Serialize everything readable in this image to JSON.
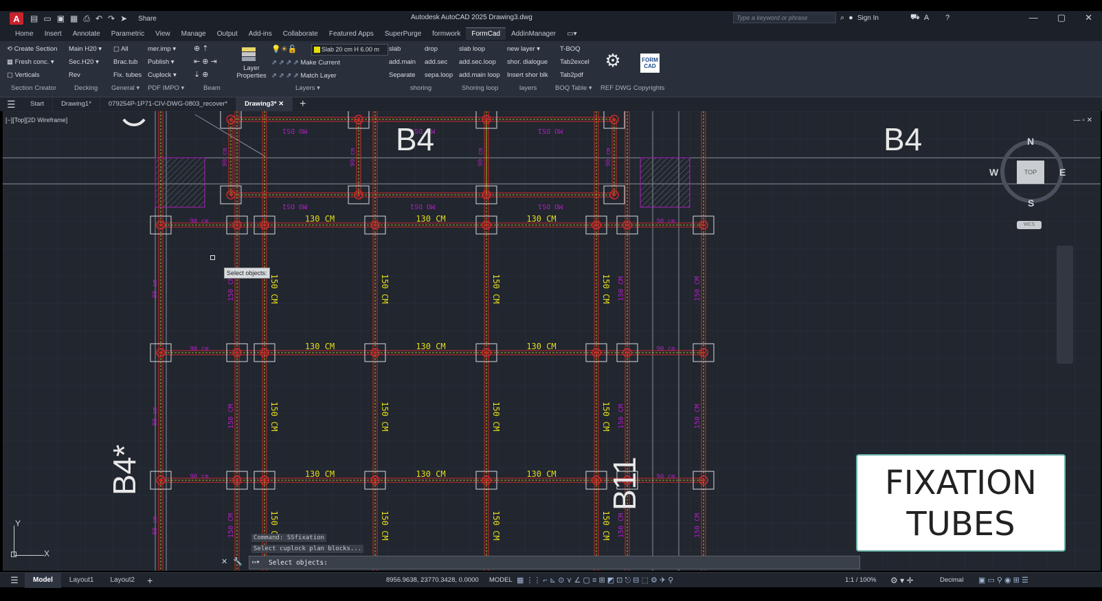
{
  "titlebar": {
    "app_logo": "A",
    "share": "Share",
    "title": "Autodesk AutoCAD 2025   Drawing3.dwg",
    "search_placeholder": "Type a keyword or phrase",
    "sign_in": "Sign In"
  },
  "menu_tabs": [
    "Home",
    "Insert",
    "Annotate",
    "Parametric",
    "View",
    "Manage",
    "Output",
    "Add-ins",
    "Collaborate",
    "Featured Apps",
    "SuperPurge",
    "formwork",
    "FormCad",
    "AddinManager"
  ],
  "ribbon": {
    "col1": [
      "Create Section",
      "Fresh conc.",
      "Verticals"
    ],
    "col1_group": "Section Creator",
    "col2": [
      "Main H20",
      "Sec.H20",
      ""
    ],
    "col2_group": "Decking",
    "col3": [
      "All",
      "Brac.tub",
      "Fix. tubes"
    ],
    "col3_group": "General",
    "col4": [
      "mer.imp",
      "Publish",
      "Cuplock"
    ],
    "col4_group": "PDF IMPO",
    "col5_group": "Beam",
    "layer_props": "Layer Properties",
    "layer_combo": "Slab 20 cm H 6.00 m",
    "make_current": "Make Current",
    "match_layer": "Match Layer",
    "layers_group": "Layers",
    "col_shoring": [
      "slab",
      "add.main",
      "Separate"
    ],
    "col_shoring2": [
      "drop",
      "add.sec",
      "sepa.loop"
    ],
    "shoring_group": "shoring",
    "col_loop": [
      "slab loop",
      "add.sec.loop",
      "add.main loop"
    ],
    "loop_group": "Shoring loop",
    "col_layers": [
      "new layer",
      "shor. dialogue",
      "Insert shor blk"
    ],
    "layers2_group": "layers",
    "col_boq": [
      "T-BOQ",
      "Tab2excel",
      "Tab2pdf"
    ],
    "boq_group": "BOQ Table",
    "ref_group": "REF DWG",
    "copy_group": "Copyrights",
    "formcad_logo": "FORM CAD",
    "rev": "Rev"
  },
  "doc_tabs": [
    "Start",
    "Drawing1*",
    "079254P-1P71-CIV-DWG-0803_recover*",
    "Drawing3*"
  ],
  "viewport": {
    "label": "[−][Top][2D Wireframe]",
    "b4_top": "B4",
    "b4_right": "B4",
    "b4_left": "B4*",
    "b11": "B11",
    "tooltip": "Select objects:",
    "dims_h": "130 CM",
    "dims_v": "150 CM",
    "dims_top": "MO DS1",
    "dims_small": "90 cm",
    "compass": {
      "n": "N",
      "s": "S",
      "e": "E",
      "w": "W",
      "top": "TOP",
      "wcs": "WCS"
    },
    "ucs_y": "Y",
    "ucs_x": "X"
  },
  "overlay": {
    "line1": "FIXATION",
    "line2": "TUBES"
  },
  "command": {
    "hist1": "Command: SSfixation",
    "hist2": "Select cuplock plan blocks...",
    "prompt": "Select objects:"
  },
  "statusbar": {
    "tabs": [
      "Model",
      "Layout1",
      "Layout2"
    ],
    "coords": "8956.9638, 23770.3428, 0.0000",
    "model": "MODEL",
    "scale": "1:1 / 100%",
    "units": "Decimal"
  },
  "colors": {
    "grid_bg": "#21262f",
    "beam": "#cc2a2a",
    "dim_yellow": "#e6dd1a",
    "dim_magenta": "#b020c0",
    "ribbon_bg": "#2a303b"
  }
}
